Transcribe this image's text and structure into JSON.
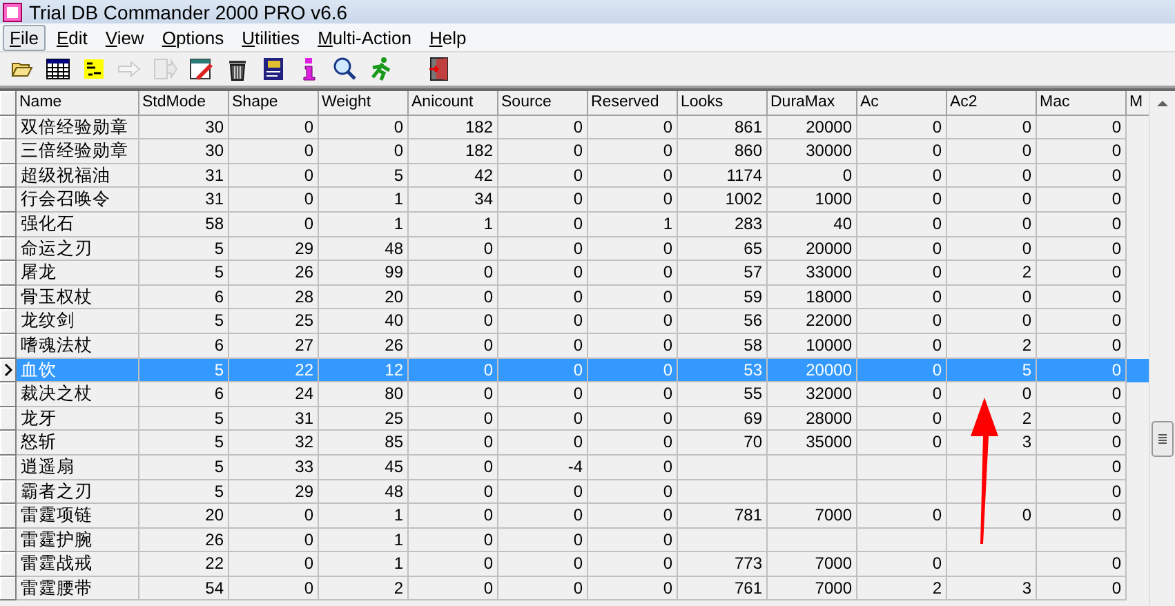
{
  "window": {
    "title": "Trial DB Commander 2000 PRO v6.6"
  },
  "menu": [
    {
      "label": "File",
      "selected": true
    },
    {
      "label": "Edit",
      "selected": false
    },
    {
      "label": "View",
      "selected": false
    },
    {
      "label": "Options",
      "selected": false
    },
    {
      "label": "Utilities",
      "selected": false
    },
    {
      "label": "Multi-Action",
      "selected": false
    },
    {
      "label": "Help",
      "selected": false
    }
  ],
  "toolbar": [
    {
      "kind": "open",
      "disabled": false
    },
    {
      "kind": "table",
      "disabled": false
    },
    {
      "kind": "sql",
      "disabled": false
    },
    {
      "kind": "arrow",
      "disabled": true
    },
    {
      "kind": "export",
      "disabled": true
    },
    {
      "kind": "edit",
      "disabled": false
    },
    {
      "kind": "trash",
      "disabled": false
    },
    {
      "kind": "report",
      "disabled": false
    },
    {
      "kind": "info",
      "disabled": false
    },
    {
      "kind": "search",
      "disabled": false
    },
    {
      "kind": "run",
      "disabled": false
    },
    {
      "kind": "exit",
      "disabled": false
    }
  ],
  "table": {
    "columns": [
      "Name",
      "StdMode",
      "Shape",
      "Weight",
      "Anicount",
      "Source",
      "Reserved",
      "Looks",
      "DuraMax",
      "Ac",
      "Ac2",
      "Mac",
      "M"
    ],
    "rows": [
      {
        "selected": false,
        "cells": [
          "双倍经验勋章",
          "30",
          "0",
          "0",
          "182",
          "0",
          "0",
          "861",
          "20000",
          "0",
          "0",
          "0"
        ]
      },
      {
        "selected": false,
        "cells": [
          "三倍经验勋章",
          "30",
          "0",
          "0",
          "182",
          "0",
          "0",
          "860",
          "30000",
          "0",
          "0",
          "0"
        ]
      },
      {
        "selected": false,
        "cells": [
          "超级祝福油",
          "31",
          "0",
          "5",
          "42",
          "0",
          "0",
          "1174",
          "0",
          "0",
          "0",
          "0"
        ]
      },
      {
        "selected": false,
        "cells": [
          "行会召唤令",
          "31",
          "0",
          "1",
          "34",
          "0",
          "0",
          "1002",
          "1000",
          "0",
          "0",
          "0"
        ]
      },
      {
        "selected": false,
        "cells": [
          "强化石",
          "58",
          "0",
          "1",
          "1",
          "0",
          "1",
          "283",
          "40",
          "0",
          "0",
          "0"
        ]
      },
      {
        "selected": false,
        "cells": [
          "命运之刃",
          "5",
          "29",
          "48",
          "0",
          "0",
          "0",
          "65",
          "20000",
          "0",
          "0",
          "0"
        ]
      },
      {
        "selected": false,
        "cells": [
          "屠龙",
          "5",
          "26",
          "99",
          "0",
          "0",
          "0",
          "57",
          "33000",
          "0",
          "2",
          "0"
        ]
      },
      {
        "selected": false,
        "cells": [
          "骨玉权杖",
          "6",
          "28",
          "20",
          "0",
          "0",
          "0",
          "59",
          "18000",
          "0",
          "0",
          "0"
        ]
      },
      {
        "selected": false,
        "cells": [
          "龙纹剑",
          "5",
          "25",
          "40",
          "0",
          "0",
          "0",
          "56",
          "22000",
          "0",
          "0",
          "0"
        ]
      },
      {
        "selected": false,
        "cells": [
          "嗜魂法杖",
          "6",
          "27",
          "26",
          "0",
          "0",
          "0",
          "58",
          "10000",
          "0",
          "2",
          "0"
        ]
      },
      {
        "selected": true,
        "cells": [
          "血饮",
          "5",
          "22",
          "12",
          "0",
          "0",
          "0",
          "53",
          "20000",
          "0",
          "5",
          "0"
        ]
      },
      {
        "selected": false,
        "cells": [
          "裁决之杖",
          "6",
          "24",
          "80",
          "0",
          "0",
          "0",
          "55",
          "32000",
          "0",
          "0",
          "0"
        ]
      },
      {
        "selected": false,
        "cells": [
          "龙牙",
          "5",
          "31",
          "25",
          "0",
          "0",
          "0",
          "69",
          "28000",
          "0",
          "2",
          "0"
        ]
      },
      {
        "selected": false,
        "cells": [
          "怒斩",
          "5",
          "32",
          "85",
          "0",
          "0",
          "0",
          "70",
          "35000",
          "0",
          "3",
          "0"
        ]
      },
      {
        "selected": false,
        "cells": [
          "逍遥扇",
          "5",
          "33",
          "45",
          "0",
          "-4",
          "0",
          null,
          null,
          null,
          null,
          "0"
        ]
      },
      {
        "selected": false,
        "cells": [
          "霸者之刃",
          "5",
          "29",
          "48",
          "0",
          "0",
          "0",
          null,
          null,
          null,
          null,
          "0"
        ]
      },
      {
        "selected": false,
        "cells": [
          "雷霆项链",
          "20",
          "0",
          "1",
          "0",
          "0",
          "0",
          "781",
          "7000",
          "0",
          "0",
          "0"
        ]
      },
      {
        "selected": false,
        "cells": [
          "雷霆护腕",
          "26",
          "0",
          "1",
          "0",
          "0",
          "0",
          null,
          null,
          null,
          null,
          null
        ]
      },
      {
        "selected": false,
        "cells": [
          "雷霆战戒",
          "22",
          "0",
          "1",
          "0",
          "0",
          "0",
          "773",
          "7000",
          "0",
          null,
          "0"
        ]
      },
      {
        "selected": false,
        "cells": [
          "雷霆腰带",
          "54",
          "0",
          "2",
          "0",
          "0",
          "0",
          "761",
          "7000",
          "2",
          "3",
          "0"
        ]
      }
    ]
  }
}
